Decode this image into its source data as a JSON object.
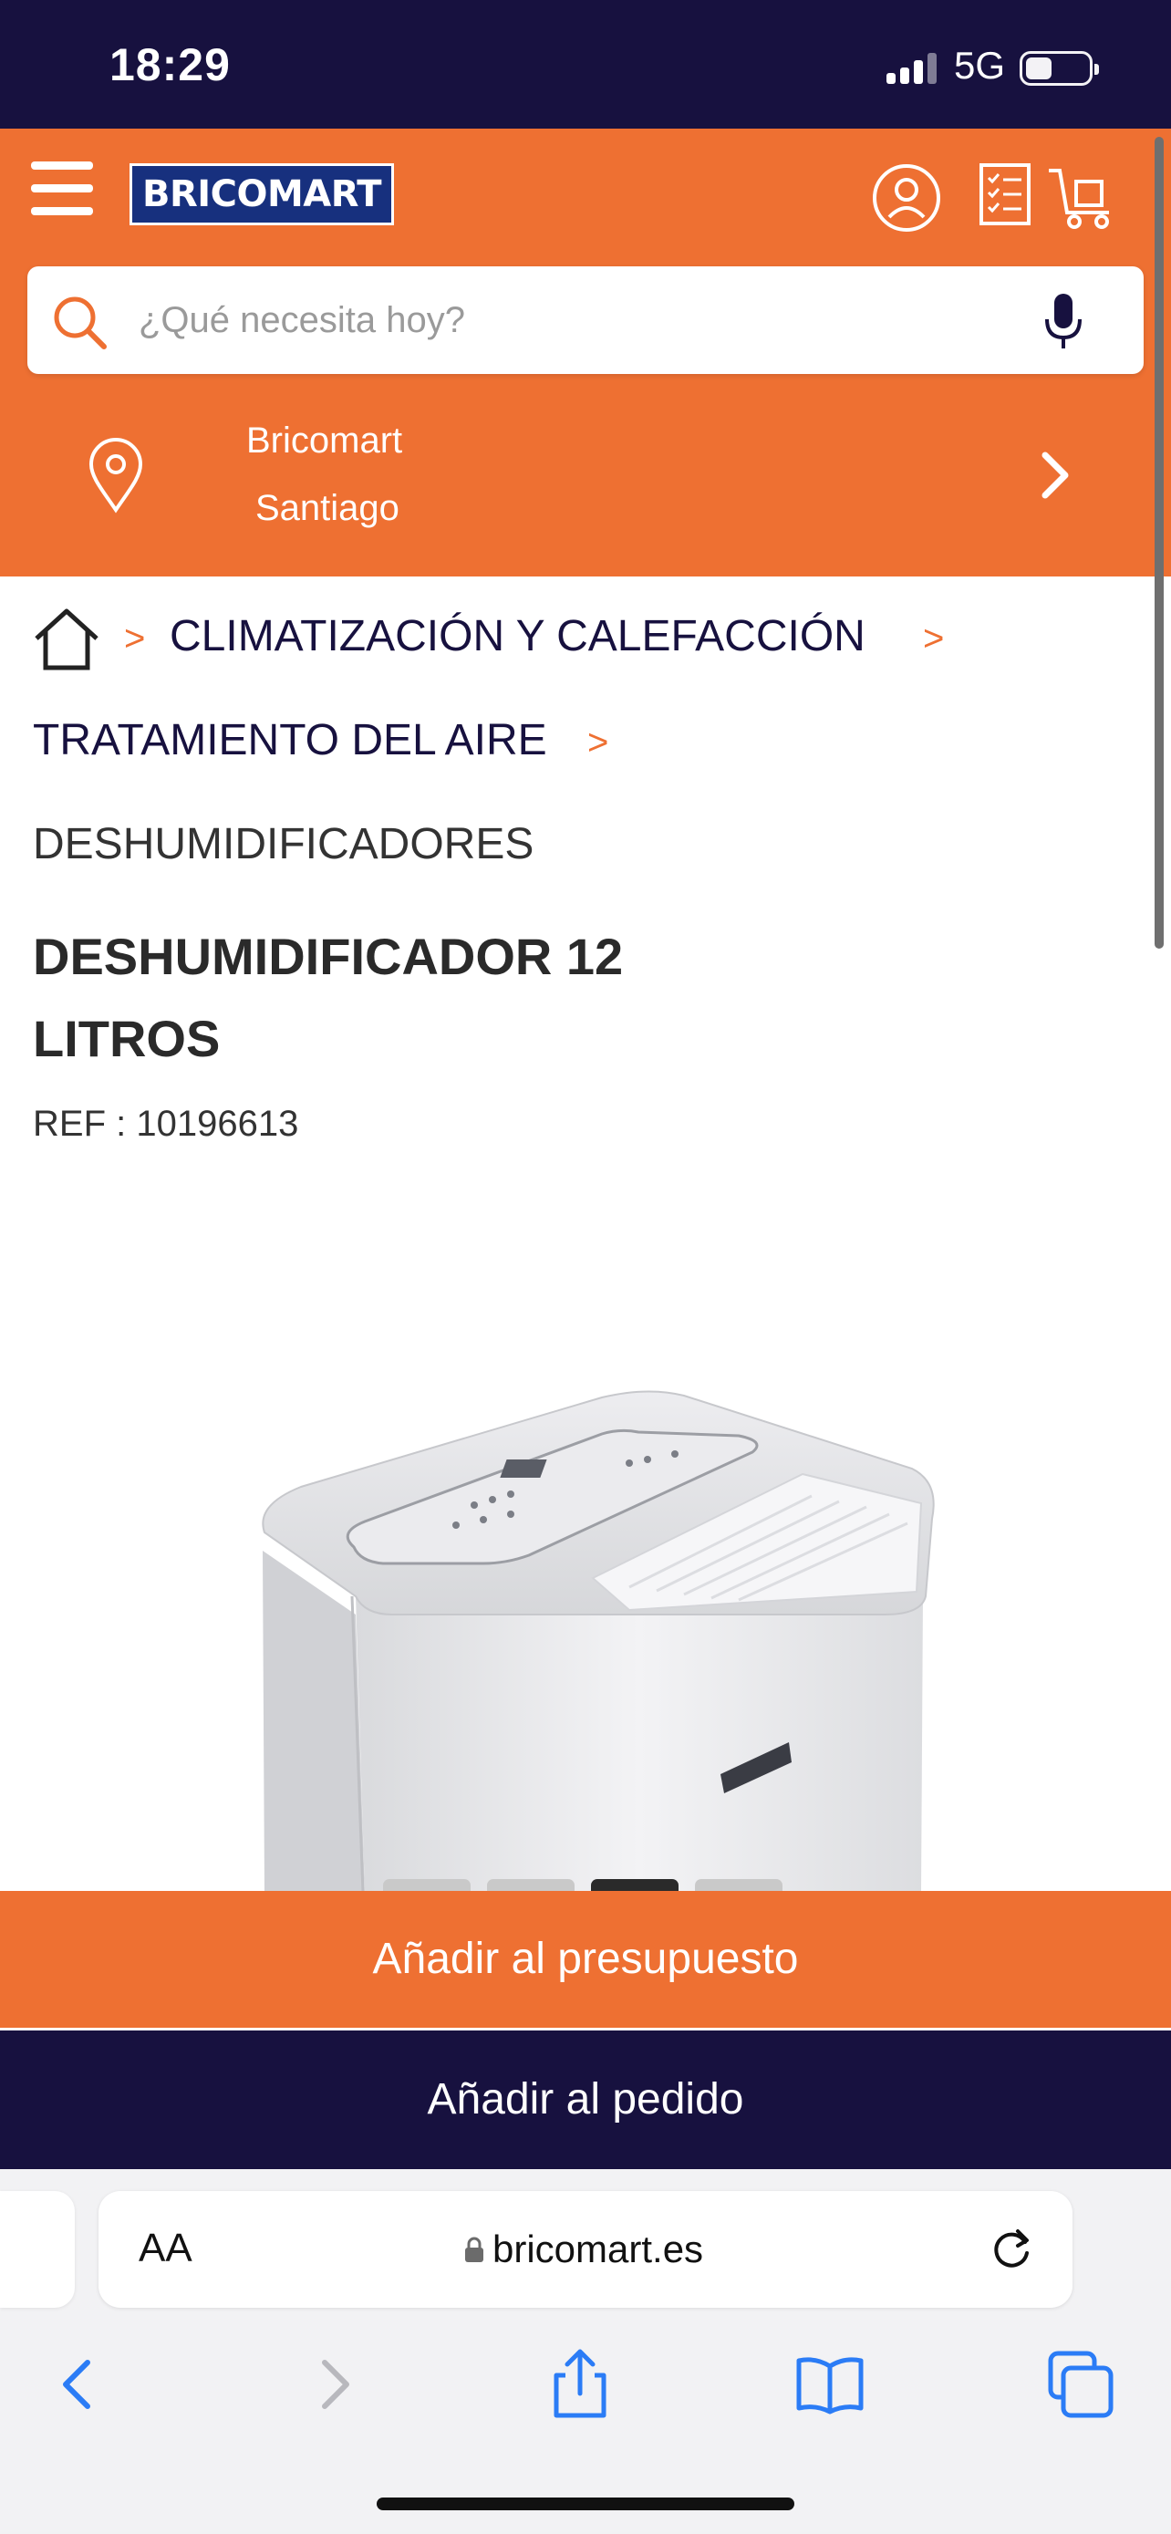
{
  "status_bar": {
    "time": "18:29",
    "network": "5G"
  },
  "header": {
    "logo_text": "BRICOMART",
    "search": {
      "placeholder": "¿Qué necesita hoy?",
      "value": ""
    },
    "store": {
      "line1": "Bricomart",
      "line2": "Santiago"
    },
    "icons": [
      "menu-icon",
      "user-icon",
      "list-icon",
      "cart-icon",
      "search-icon",
      "microphone-icon",
      "location-pin-icon",
      "chevron-right-icon"
    ]
  },
  "breadcrumb": {
    "items": [
      "CLIMATIZACIÓN Y CALEFACCIÓN",
      "TRATAMIENTO DEL AIRE"
    ],
    "current": "DESHUMIDIFICADORES",
    "separator": ">"
  },
  "product": {
    "title_line1": "DESHUMIDIFICADOR 12",
    "title_line2": "LITROS",
    "ref": "REF : 10196613",
    "image_dots": 4,
    "active_dot": 3
  },
  "actions": {
    "budget_label": "Añadir al presupuesto",
    "order_label": "Añadir al pedido"
  },
  "browser": {
    "aa_label": "AA",
    "url": "bricomart.es"
  },
  "colors": {
    "brand_orange": "#ee7032",
    "brand_navy": "#17113f",
    "logo_blue": "#17307e"
  }
}
